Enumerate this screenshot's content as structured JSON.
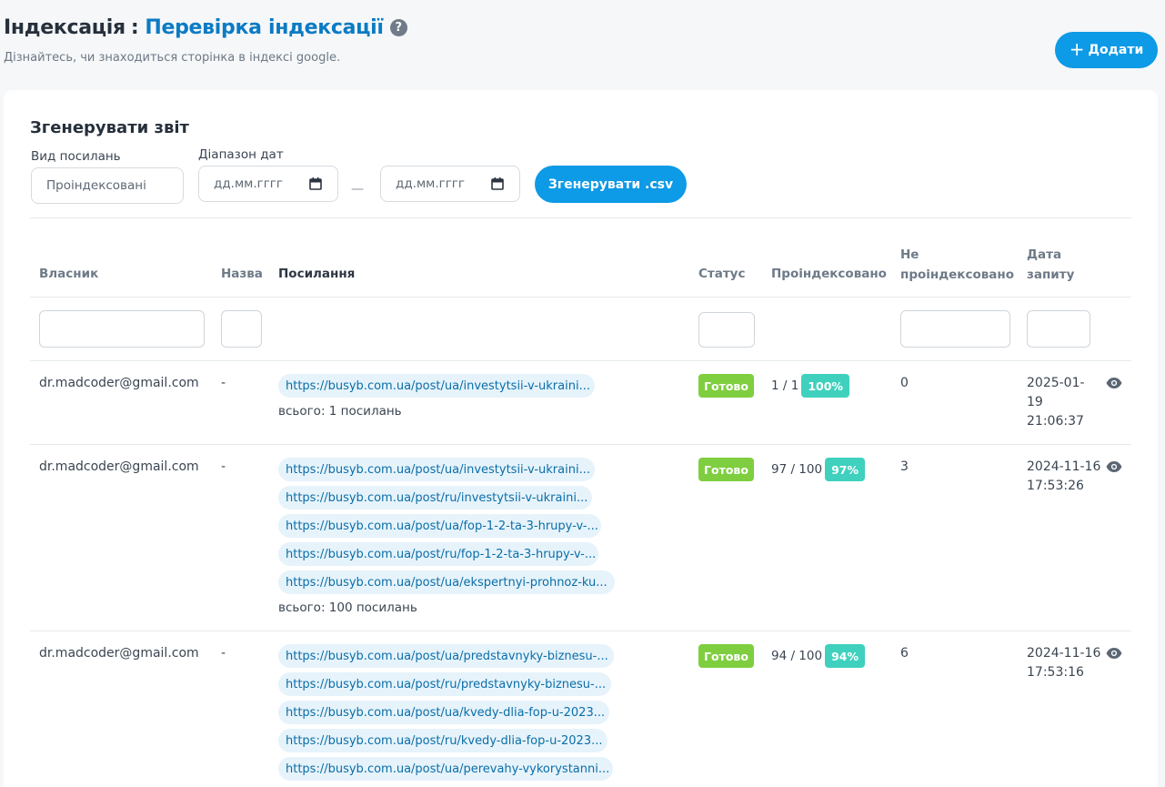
{
  "header": {
    "title_prefix": "Індексація",
    "title_sep": ":",
    "title_main": "Перевірка індексації",
    "help_glyph": "?",
    "subtitle": "Дізнайтесь, чи знаходиться сторінка в індексі google.",
    "add_plus": "+",
    "add_label": "Додати"
  },
  "report": {
    "title": "Згенерувати звіт",
    "link_type_label": "Вид посилань",
    "link_type_value": "Проіндексовані",
    "date_range_label": "Діапазон дат",
    "date_from_placeholder": "дд.мм.гггг",
    "date_to_placeholder": "дд.мм.гггг",
    "date_separator": "—",
    "generate_label": "Згенерувати .csv"
  },
  "table": {
    "columns": {
      "owner": "Власник",
      "name": "Назва",
      "links": "Посилання",
      "status": "Статус",
      "indexed": "Проіндексовано",
      "not_indexed_1": "Не",
      "not_indexed_2": "проіндексовано",
      "date_1": "Дата",
      "date_2": "запиту"
    },
    "rows": [
      {
        "owner": "dr.madcoder@gmail.com",
        "name": "-",
        "links": [
          "https://busyb.com.ua/post/ua/investytsii-v-ukraini..."
        ],
        "total": "всього: 1 посилань",
        "status": "Готово",
        "indexed": "1 / 1",
        "percent": "100%",
        "not_indexed": "0",
        "date_1": "2025-01-",
        "date_2": "19",
        "date_3": "21:06:37"
      },
      {
        "owner": "dr.madcoder@gmail.com",
        "name": "-",
        "links": [
          "https://busyb.com.ua/post/ua/investytsii-v-ukraini...",
          "https://busyb.com.ua/post/ru/investytsii-v-ukraini...",
          "https://busyb.com.ua/post/ua/fop-1-2-ta-3-hrupy-v-...",
          "https://busyb.com.ua/post/ru/fop-1-2-ta-3-hrupy-v-...",
          "https://busyb.com.ua/post/ua/ekspertnyi-prohnoz-ku..."
        ],
        "total": "всього: 100 посилань",
        "status": "Готово",
        "indexed": "97 / 100",
        "percent": "97%",
        "not_indexed": "3",
        "date_1": "2024-11-16",
        "date_2": "17:53:26"
      },
      {
        "owner": "dr.madcoder@gmail.com",
        "name": "-",
        "links": [
          "https://busyb.com.ua/post/ua/predstavnyky-biznesu-...",
          "https://busyb.com.ua/post/ru/predstavnyky-biznesu-...",
          "https://busyb.com.ua/post/ua/kvedy-dlia-fop-u-2023...",
          "https://busyb.com.ua/post/ru/kvedy-dlia-fop-u-2023...",
          "https://busyb.com.ua/post/ua/perevahy-vykorystanni..."
        ],
        "status": "Готово",
        "indexed": "94 / 100",
        "percent": "94%",
        "not_indexed": "6",
        "date_1": "2024-11-16",
        "date_2": "17:53:16"
      }
    ]
  },
  "colors": {
    "primary": "#0d9ae6",
    "title_accent": "#0b7bc4",
    "status_ready": "#7fce3f",
    "percent_badge": "#3fd1bd",
    "link_chip_bg": "#e6f3fb"
  },
  "icons": {
    "help": "question-circle-icon",
    "add": "plus-icon",
    "calendar": "calendar-icon",
    "view": "eye-icon"
  }
}
